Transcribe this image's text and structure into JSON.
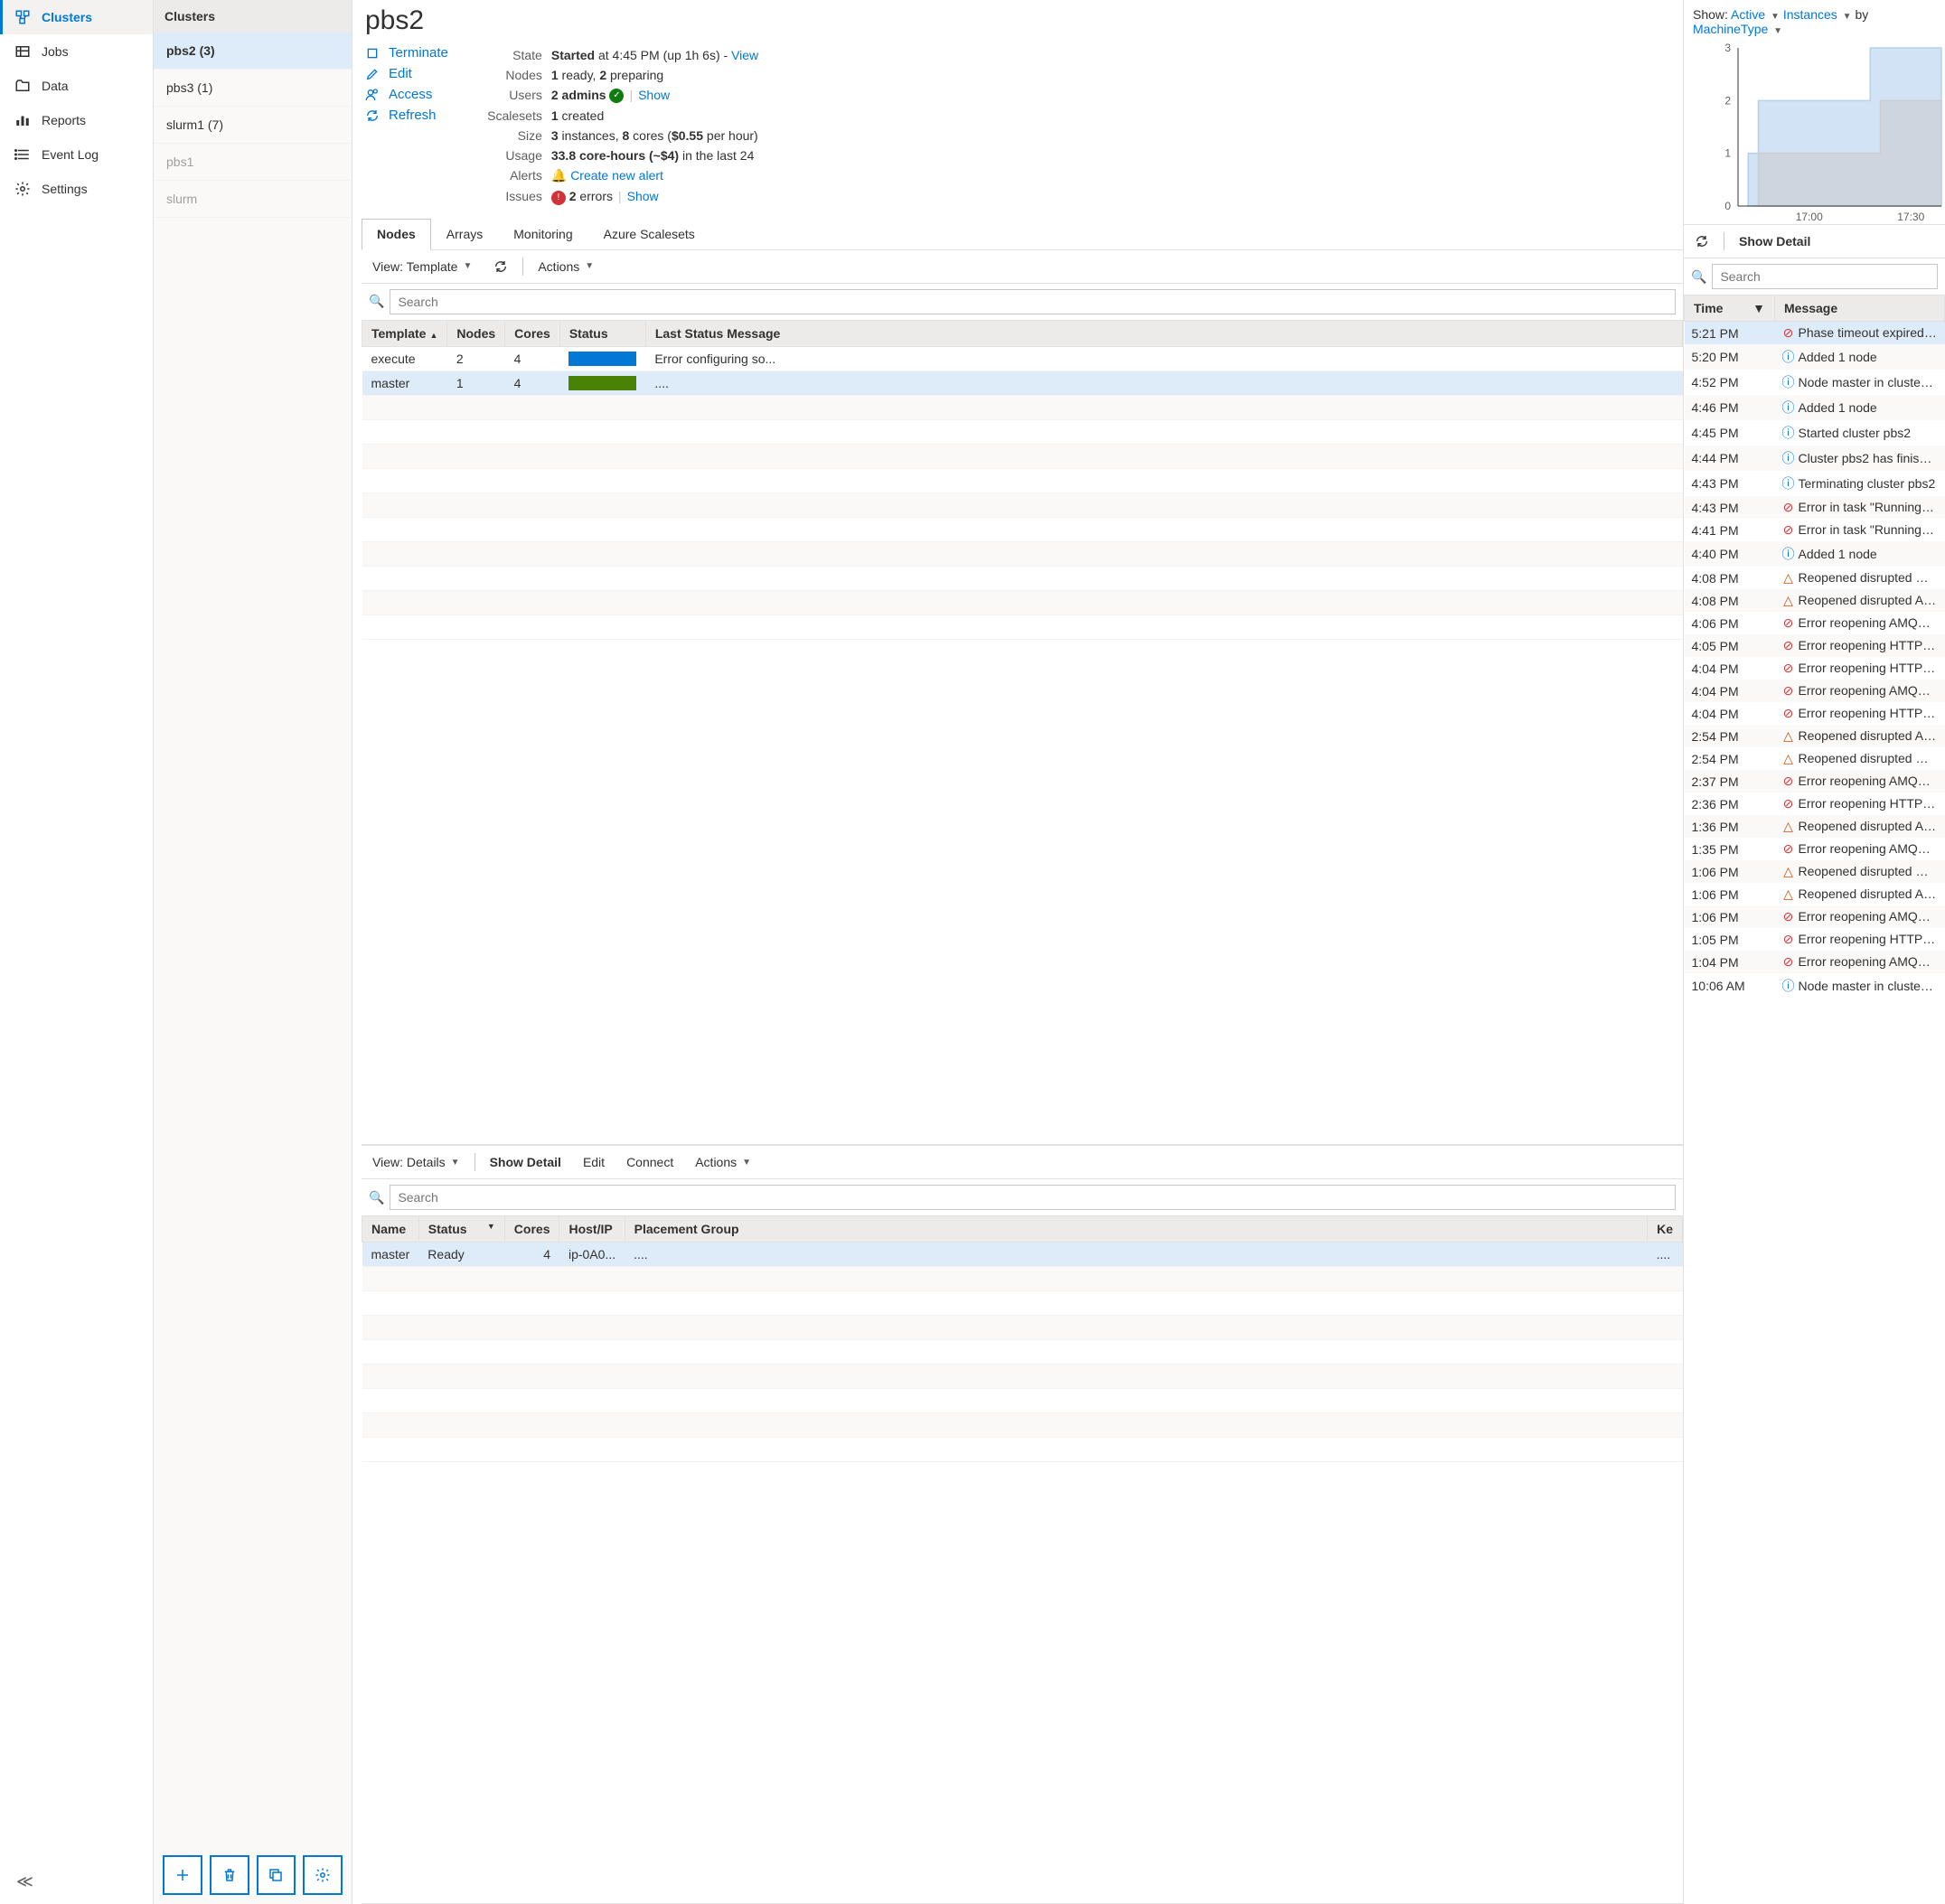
{
  "nav": {
    "items": [
      {
        "label": "Clusters",
        "icon": "clusters"
      },
      {
        "label": "Jobs",
        "icon": "jobs"
      },
      {
        "label": "Data",
        "icon": "data"
      },
      {
        "label": "Reports",
        "icon": "reports"
      },
      {
        "label": "Event Log",
        "icon": "eventlog"
      },
      {
        "label": "Settings",
        "icon": "settings"
      }
    ]
  },
  "clusters": {
    "header": "Clusters",
    "items": [
      {
        "label": "pbs2 (3)",
        "selected": true
      },
      {
        "label": "pbs3 (1)"
      },
      {
        "label": "slurm1 (7)"
      },
      {
        "label": "pbs1",
        "faded": true
      },
      {
        "label": "slurm",
        "faded": true
      }
    ]
  },
  "title": "pbs2",
  "actions": {
    "terminate": "Terminate",
    "edit": "Edit",
    "access": "Access",
    "refresh": "Refresh"
  },
  "meta": {
    "state": {
      "label": "State",
      "bold": "Started",
      "rest": " at 4:45 PM (up 1h 6s) - ",
      "link": "View"
    },
    "nodes": {
      "label": "Nodes",
      "bold": "1",
      "rest1": " ready, ",
      "bold2": "2",
      "rest2": " preparing"
    },
    "users": {
      "label": "Users",
      "bold": "2 admins",
      "link": "Show"
    },
    "scalesets": {
      "label": "Scalesets",
      "bold": "1",
      "rest": " created"
    },
    "size": {
      "label": "Size",
      "bold": "3",
      "rest1": " instances, ",
      "bold2": "8",
      "rest2": " cores (",
      "bold3": "$0.55",
      "rest3": " per hour)"
    },
    "usage": {
      "label": "Usage",
      "bold": "33.8 core-hours (~$4)",
      "rest": " in the last 24"
    },
    "alerts": {
      "label": "Alerts",
      "link": "Create new alert"
    },
    "issues": {
      "label": "Issues",
      "bold": "2",
      "rest": " errors",
      "link": "Show"
    }
  },
  "tabs": [
    {
      "label": "Nodes",
      "active": true
    },
    {
      "label": "Arrays"
    },
    {
      "label": "Monitoring"
    },
    {
      "label": "Azure Scalesets"
    }
  ],
  "templates": {
    "toolbar": {
      "view": "View: Template",
      "actions": "Actions"
    },
    "search_placeholder": "Search",
    "headers": [
      "Template",
      "Nodes",
      "Cores",
      "Status",
      "Last Status Message"
    ],
    "rows": [
      {
        "template": "execute",
        "nodes": "2",
        "cores": "4",
        "status": "blue",
        "msg": "Error configuring so..."
      },
      {
        "template": "master",
        "nodes": "1",
        "cores": "4",
        "status": "green",
        "msg": "....",
        "sel": true
      }
    ]
  },
  "details": {
    "toolbar": {
      "view": "View: Details",
      "show_detail": "Show Detail",
      "edit": "Edit",
      "connect": "Connect",
      "actions": "Actions"
    },
    "search_placeholder": "Search",
    "headers": [
      "Name",
      "Status",
      "Cores",
      "Host/IP",
      "Placement Group",
      "Ke"
    ],
    "rows": [
      {
        "name": "master",
        "status": "Ready",
        "cores": "4",
        "host": "ip-0A0...",
        "pg": "....",
        "ke": "....",
        "sel": true
      }
    ]
  },
  "right": {
    "show_prefix": "Show: ",
    "show_link1": "Active",
    "show_link2": "Instances",
    "show_by": " by",
    "machine_type": "MachineType",
    "show_detail": "Show Detail",
    "search_placeholder": "Search",
    "headers": {
      "time": "Time",
      "message": "Message"
    },
    "events": [
      {
        "t": "5:21 PM",
        "i": "err",
        "m": "Phase timeout expired whi",
        "sel": true
      },
      {
        "t": "5:20 PM",
        "i": "info",
        "m": "Added 1 node"
      },
      {
        "t": "4:52 PM",
        "i": "info",
        "m": "Node master in cluster pbs"
      },
      {
        "t": "4:46 PM",
        "i": "info",
        "m": "Added 1 node"
      },
      {
        "t": "4:45 PM",
        "i": "info",
        "m": "Started cluster pbs2"
      },
      {
        "t": "4:44 PM",
        "i": "info",
        "m": "Cluster pbs2 has finished te"
      },
      {
        "t": "4:43 PM",
        "i": "info",
        "m": "Terminating cluster pbs2"
      },
      {
        "t": "4:43 PM",
        "i": "err",
        "m": "Error in task \"Running phas"
      },
      {
        "t": "4:41 PM",
        "i": "err",
        "m": "Error in task \"Running phas"
      },
      {
        "t": "4:40 PM",
        "i": "info",
        "m": "Added 1 node"
      },
      {
        "t": "4:08 PM",
        "i": "warn",
        "m": "Reopened disrupted HTTPS"
      },
      {
        "t": "4:08 PM",
        "i": "warn",
        "m": "Reopened disrupted AMQP"
      },
      {
        "t": "4:06 PM",
        "i": "err",
        "m": "Error reopening AMQP tun"
      },
      {
        "t": "4:05 PM",
        "i": "err",
        "m": "Error reopening HTTPS tun"
      },
      {
        "t": "4:04 PM",
        "i": "err",
        "m": "Error reopening HTTPS tun"
      },
      {
        "t": "4:04 PM",
        "i": "err",
        "m": "Error reopening AMQP tun"
      },
      {
        "t": "4:04 PM",
        "i": "err",
        "m": "Error reopening HTTPS tun"
      },
      {
        "t": "2:54 PM",
        "i": "warn",
        "m": "Reopened disrupted AMQP"
      },
      {
        "t": "2:54 PM",
        "i": "warn",
        "m": "Reopened disrupted HTTPS"
      },
      {
        "t": "2:37 PM",
        "i": "err",
        "m": "Error reopening AMQP tun"
      },
      {
        "t": "2:36 PM",
        "i": "err",
        "m": "Error reopening HTTPS tun"
      },
      {
        "t": "1:36 PM",
        "i": "warn",
        "m": "Reopened disrupted AMQP"
      },
      {
        "t": "1:35 PM",
        "i": "err",
        "m": "Error reopening AMQP tun"
      },
      {
        "t": "1:06 PM",
        "i": "warn",
        "m": "Reopened disrupted HTTPS"
      },
      {
        "t": "1:06 PM",
        "i": "warn",
        "m": "Reopened disrupted AMQP"
      },
      {
        "t": "1:06 PM",
        "i": "err",
        "m": "Error reopening AMQP tun"
      },
      {
        "t": "1:05 PM",
        "i": "err",
        "m": "Error reopening HTTPS tun"
      },
      {
        "t": "1:04 PM",
        "i": "err",
        "m": "Error reopening AMQP tun"
      },
      {
        "t": "10:06 AM",
        "i": "info",
        "m": "Node master in cluster pbs"
      }
    ]
  },
  "chart_data": {
    "type": "area",
    "x_ticks": [
      "17:00",
      "17:30"
    ],
    "ylim": [
      0,
      3
    ],
    "series": [
      {
        "name": "series1",
        "color": "#b3d1ed",
        "steps": [
          [
            0.05,
            1
          ],
          [
            0.1,
            2
          ],
          [
            0.6,
            2
          ],
          [
            0.65,
            3
          ],
          [
            1.0,
            3
          ]
        ]
      },
      {
        "name": "series2",
        "color": "#f3c6a5",
        "steps": [
          [
            0.08,
            0
          ],
          [
            0.1,
            1
          ],
          [
            0.65,
            1
          ],
          [
            0.7,
            2
          ],
          [
            1.0,
            2
          ]
        ]
      }
    ]
  }
}
